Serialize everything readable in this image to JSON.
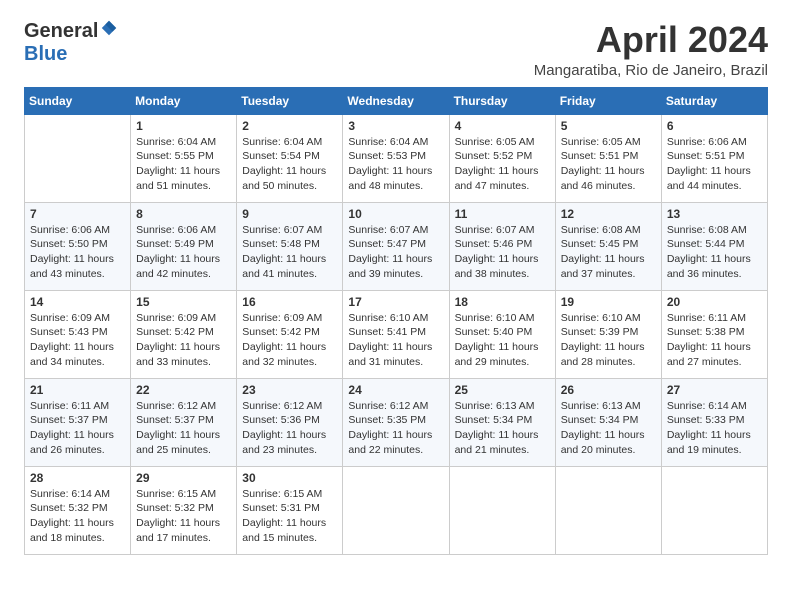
{
  "header": {
    "logo_general": "General",
    "logo_blue": "Blue",
    "month_title": "April 2024",
    "location": "Mangaratiba, Rio de Janeiro, Brazil"
  },
  "days_of_week": [
    "Sunday",
    "Monday",
    "Tuesday",
    "Wednesday",
    "Thursday",
    "Friday",
    "Saturday"
  ],
  "weeks": [
    [
      {
        "day": "",
        "sunrise": "",
        "sunset": "",
        "daylight": ""
      },
      {
        "day": "1",
        "sunrise": "Sunrise: 6:04 AM",
        "sunset": "Sunset: 5:55 PM",
        "daylight": "Daylight: 11 hours and 51 minutes."
      },
      {
        "day": "2",
        "sunrise": "Sunrise: 6:04 AM",
        "sunset": "Sunset: 5:54 PM",
        "daylight": "Daylight: 11 hours and 50 minutes."
      },
      {
        "day": "3",
        "sunrise": "Sunrise: 6:04 AM",
        "sunset": "Sunset: 5:53 PM",
        "daylight": "Daylight: 11 hours and 48 minutes."
      },
      {
        "day": "4",
        "sunrise": "Sunrise: 6:05 AM",
        "sunset": "Sunset: 5:52 PM",
        "daylight": "Daylight: 11 hours and 47 minutes."
      },
      {
        "day": "5",
        "sunrise": "Sunrise: 6:05 AM",
        "sunset": "Sunset: 5:51 PM",
        "daylight": "Daylight: 11 hours and 46 minutes."
      },
      {
        "day": "6",
        "sunrise": "Sunrise: 6:06 AM",
        "sunset": "Sunset: 5:51 PM",
        "daylight": "Daylight: 11 hours and 44 minutes."
      }
    ],
    [
      {
        "day": "7",
        "sunrise": "Sunrise: 6:06 AM",
        "sunset": "Sunset: 5:50 PM",
        "daylight": "Daylight: 11 hours and 43 minutes."
      },
      {
        "day": "8",
        "sunrise": "Sunrise: 6:06 AM",
        "sunset": "Sunset: 5:49 PM",
        "daylight": "Daylight: 11 hours and 42 minutes."
      },
      {
        "day": "9",
        "sunrise": "Sunrise: 6:07 AM",
        "sunset": "Sunset: 5:48 PM",
        "daylight": "Daylight: 11 hours and 41 minutes."
      },
      {
        "day": "10",
        "sunrise": "Sunrise: 6:07 AM",
        "sunset": "Sunset: 5:47 PM",
        "daylight": "Daylight: 11 hours and 39 minutes."
      },
      {
        "day": "11",
        "sunrise": "Sunrise: 6:07 AM",
        "sunset": "Sunset: 5:46 PM",
        "daylight": "Daylight: 11 hours and 38 minutes."
      },
      {
        "day": "12",
        "sunrise": "Sunrise: 6:08 AM",
        "sunset": "Sunset: 5:45 PM",
        "daylight": "Daylight: 11 hours and 37 minutes."
      },
      {
        "day": "13",
        "sunrise": "Sunrise: 6:08 AM",
        "sunset": "Sunset: 5:44 PM",
        "daylight": "Daylight: 11 hours and 36 minutes."
      }
    ],
    [
      {
        "day": "14",
        "sunrise": "Sunrise: 6:09 AM",
        "sunset": "Sunset: 5:43 PM",
        "daylight": "Daylight: 11 hours and 34 minutes."
      },
      {
        "day": "15",
        "sunrise": "Sunrise: 6:09 AM",
        "sunset": "Sunset: 5:42 PM",
        "daylight": "Daylight: 11 hours and 33 minutes."
      },
      {
        "day": "16",
        "sunrise": "Sunrise: 6:09 AM",
        "sunset": "Sunset: 5:42 PM",
        "daylight": "Daylight: 11 hours and 32 minutes."
      },
      {
        "day": "17",
        "sunrise": "Sunrise: 6:10 AM",
        "sunset": "Sunset: 5:41 PM",
        "daylight": "Daylight: 11 hours and 31 minutes."
      },
      {
        "day": "18",
        "sunrise": "Sunrise: 6:10 AM",
        "sunset": "Sunset: 5:40 PM",
        "daylight": "Daylight: 11 hours and 29 minutes."
      },
      {
        "day": "19",
        "sunrise": "Sunrise: 6:10 AM",
        "sunset": "Sunset: 5:39 PM",
        "daylight": "Daylight: 11 hours and 28 minutes."
      },
      {
        "day": "20",
        "sunrise": "Sunrise: 6:11 AM",
        "sunset": "Sunset: 5:38 PM",
        "daylight": "Daylight: 11 hours and 27 minutes."
      }
    ],
    [
      {
        "day": "21",
        "sunrise": "Sunrise: 6:11 AM",
        "sunset": "Sunset: 5:37 PM",
        "daylight": "Daylight: 11 hours and 26 minutes."
      },
      {
        "day": "22",
        "sunrise": "Sunrise: 6:12 AM",
        "sunset": "Sunset: 5:37 PM",
        "daylight": "Daylight: 11 hours and 25 minutes."
      },
      {
        "day": "23",
        "sunrise": "Sunrise: 6:12 AM",
        "sunset": "Sunset: 5:36 PM",
        "daylight": "Daylight: 11 hours and 23 minutes."
      },
      {
        "day": "24",
        "sunrise": "Sunrise: 6:12 AM",
        "sunset": "Sunset: 5:35 PM",
        "daylight": "Daylight: 11 hours and 22 minutes."
      },
      {
        "day": "25",
        "sunrise": "Sunrise: 6:13 AM",
        "sunset": "Sunset: 5:34 PM",
        "daylight": "Daylight: 11 hours and 21 minutes."
      },
      {
        "day": "26",
        "sunrise": "Sunrise: 6:13 AM",
        "sunset": "Sunset: 5:34 PM",
        "daylight": "Daylight: 11 hours and 20 minutes."
      },
      {
        "day": "27",
        "sunrise": "Sunrise: 6:14 AM",
        "sunset": "Sunset: 5:33 PM",
        "daylight": "Daylight: 11 hours and 19 minutes."
      }
    ],
    [
      {
        "day": "28",
        "sunrise": "Sunrise: 6:14 AM",
        "sunset": "Sunset: 5:32 PM",
        "daylight": "Daylight: 11 hours and 18 minutes."
      },
      {
        "day": "29",
        "sunrise": "Sunrise: 6:15 AM",
        "sunset": "Sunset: 5:32 PM",
        "daylight": "Daylight: 11 hours and 17 minutes."
      },
      {
        "day": "30",
        "sunrise": "Sunrise: 6:15 AM",
        "sunset": "Sunset: 5:31 PM",
        "daylight": "Daylight: 11 hours and 15 minutes."
      },
      {
        "day": "",
        "sunrise": "",
        "sunset": "",
        "daylight": ""
      },
      {
        "day": "",
        "sunrise": "",
        "sunset": "",
        "daylight": ""
      },
      {
        "day": "",
        "sunrise": "",
        "sunset": "",
        "daylight": ""
      },
      {
        "day": "",
        "sunrise": "",
        "sunset": "",
        "daylight": ""
      }
    ]
  ]
}
